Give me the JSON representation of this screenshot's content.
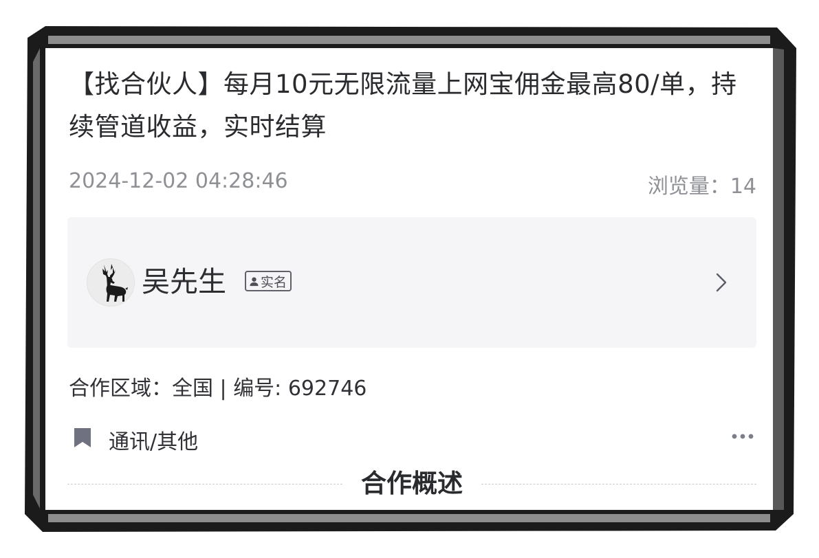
{
  "listing": {
    "title": "【找合伙人】每月10元无限流量上网宝佣金最高80/单，持续管道收益，实时结算",
    "date": "2024-12-02 04:28:46",
    "views_label": "浏览量：",
    "views": "14"
  },
  "publisher": {
    "name": "吴先生",
    "verified_label": "实名",
    "avatar_icon": "deer-icon"
  },
  "details": {
    "cooperation_label": "合作区域：",
    "cooperation_value": "全国",
    "separator": " | ",
    "number_label": "编号: ",
    "number_value": "692746",
    "category": "通讯/其他"
  },
  "section": {
    "overview_title": "合作概述"
  },
  "colors": {
    "text_primary": "#2a2b2e",
    "text_secondary": "#8e9096",
    "card_bg": "#f5f5f8",
    "icon_gray": "#6f7180"
  }
}
